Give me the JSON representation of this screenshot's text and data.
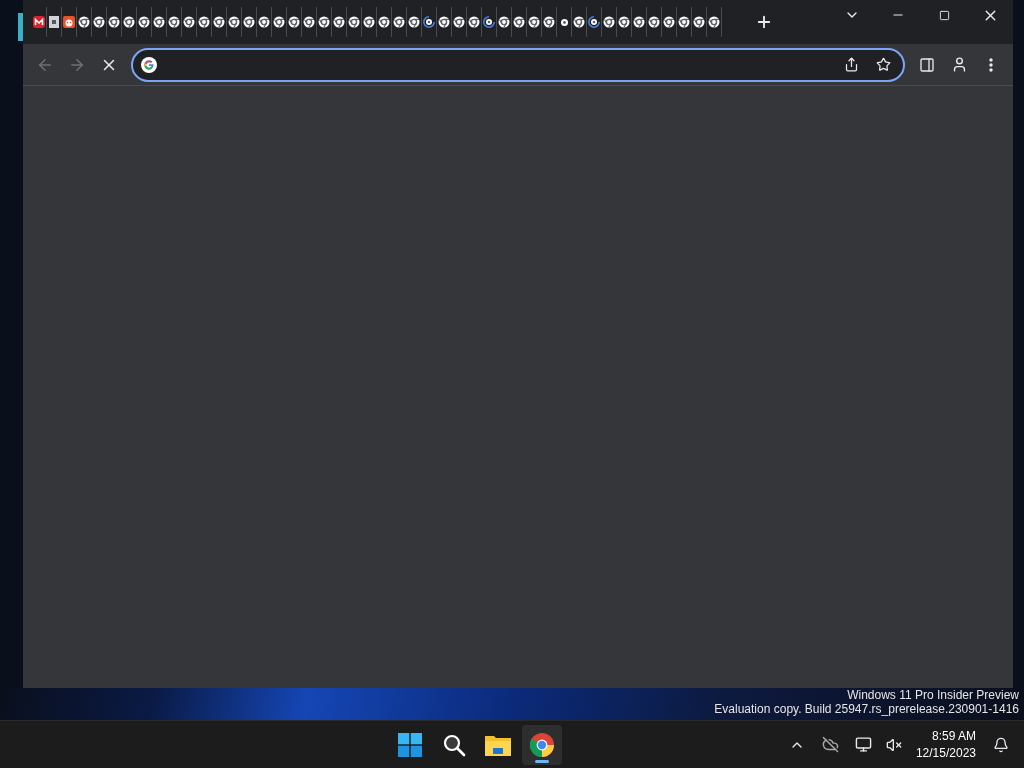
{
  "browser": {
    "tabs": [
      {
        "kind": "mail"
      },
      {
        "kind": "square"
      },
      {
        "kind": "robot"
      },
      {
        "kind": "default"
      },
      {
        "kind": "default"
      },
      {
        "kind": "default"
      },
      {
        "kind": "default"
      },
      {
        "kind": "default"
      },
      {
        "kind": "default"
      },
      {
        "kind": "default"
      },
      {
        "kind": "default"
      },
      {
        "kind": "default"
      },
      {
        "kind": "default"
      },
      {
        "kind": "default"
      },
      {
        "kind": "default"
      },
      {
        "kind": "default"
      },
      {
        "kind": "default"
      },
      {
        "kind": "default"
      },
      {
        "kind": "default"
      },
      {
        "kind": "default"
      },
      {
        "kind": "default"
      },
      {
        "kind": "default"
      },
      {
        "kind": "default"
      },
      {
        "kind": "default"
      },
      {
        "kind": "default"
      },
      {
        "kind": "default"
      },
      {
        "kind": "loading"
      },
      {
        "kind": "default"
      },
      {
        "kind": "default"
      },
      {
        "kind": "default"
      },
      {
        "kind": "loading"
      },
      {
        "kind": "default"
      },
      {
        "kind": "default"
      },
      {
        "kind": "default"
      },
      {
        "kind": "default"
      },
      {
        "kind": "dot"
      },
      {
        "kind": "default"
      },
      {
        "kind": "loading"
      },
      {
        "kind": "default"
      },
      {
        "kind": "default"
      },
      {
        "kind": "default"
      },
      {
        "kind": "default"
      },
      {
        "kind": "default"
      },
      {
        "kind": "default"
      },
      {
        "kind": "default"
      },
      {
        "kind": "default"
      }
    ],
    "nav_buttons": [
      {
        "kind": "back",
        "disabled": true
      },
      {
        "kind": "forward",
        "disabled": true
      },
      {
        "kind": "stop",
        "disabled": false
      }
    ],
    "address_bar": {
      "focused": true
    }
  },
  "desktop": {
    "watermark_lines": [
      "Windows 11 Pro Insider Preview",
      "Evaluation copy. Build 25947.rs_prerelease.230901-1416"
    ]
  },
  "taskbar": {
    "apps": [
      {
        "kind": "start",
        "selected": false
      },
      {
        "kind": "search",
        "selected": false
      },
      {
        "kind": "files",
        "selected": false
      },
      {
        "kind": "chrome",
        "selected": true
      }
    ],
    "clock": {
      "time": "8:59 AM",
      "date": "12/15/2023"
    }
  }
}
